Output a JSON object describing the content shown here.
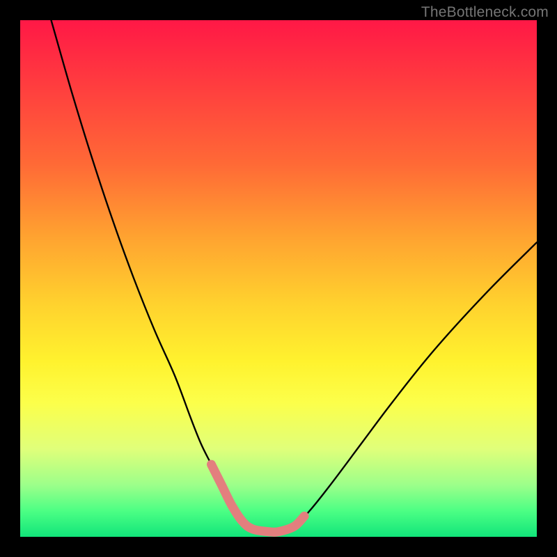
{
  "watermark": "TheBottleneck.com",
  "chart_data": {
    "type": "line",
    "title": "",
    "xlabel": "",
    "ylabel": "",
    "xlim": [
      0,
      100
    ],
    "ylim": [
      0,
      100
    ],
    "series": [
      {
        "name": "bottleneck-curve",
        "x": [
          6,
          10,
          14,
          18,
          22,
          26,
          30,
          33,
          35,
          37,
          39,
          41,
          43,
          45,
          48,
          50,
          53,
          56,
          60,
          66,
          72,
          80,
          90,
          100
        ],
        "y": [
          100,
          86,
          73,
          61,
          50,
          40,
          31,
          23,
          18,
          14,
          10,
          6,
          3,
          1.5,
          1,
          1,
          2,
          5,
          10,
          18,
          26,
          36,
          47,
          57
        ]
      },
      {
        "name": "highlight-overlay",
        "x": [
          37,
          39,
          41,
          43,
          45,
          48,
          50,
          53,
          55
        ],
        "y": [
          14,
          10,
          6,
          3,
          1.5,
          1,
          1,
          2,
          4
        ]
      }
    ],
    "colors": {
      "curve": "#000000",
      "highlight": "#e37f7e"
    }
  }
}
